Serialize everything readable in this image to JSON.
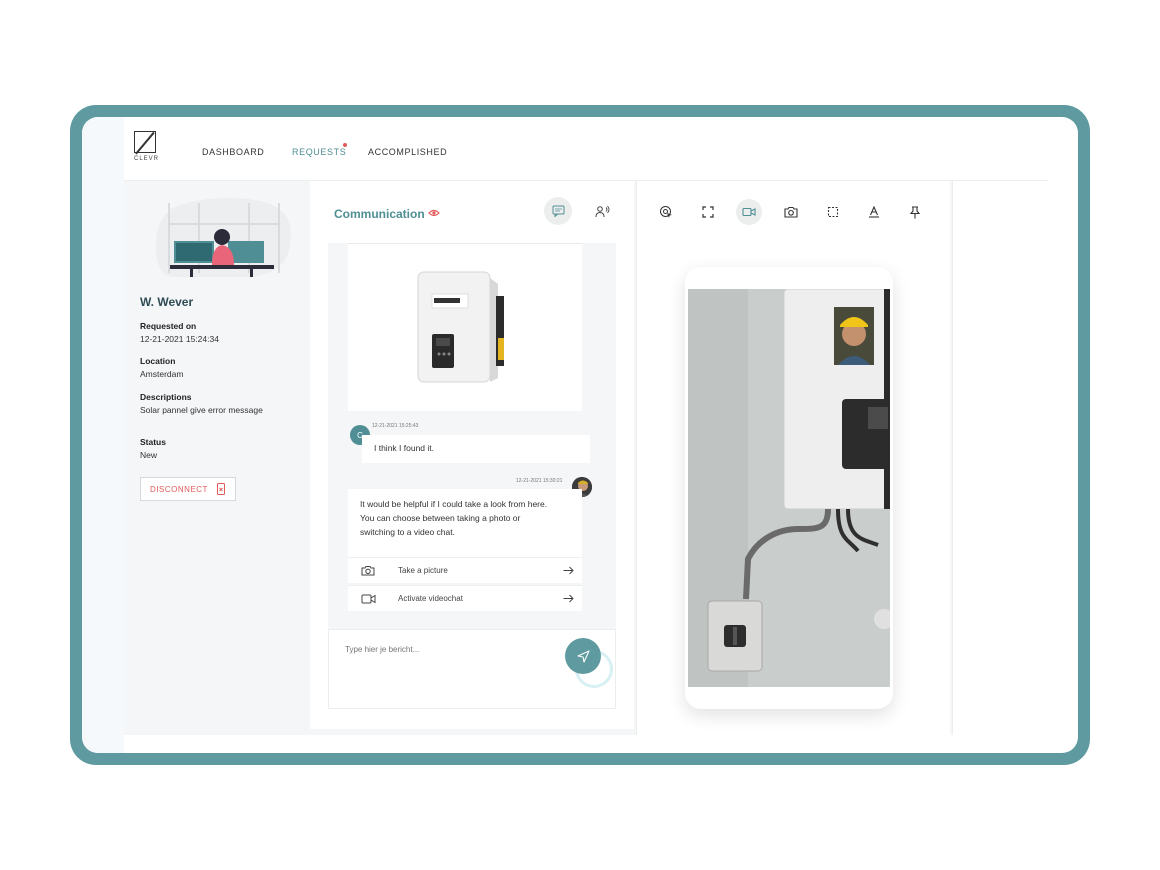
{
  "nav": {
    "logo_text": "CLEVR",
    "items": [
      {
        "label": "DASHBOARD"
      },
      {
        "label": "REQUESTS"
      },
      {
        "label": "ACCOMPLISHED"
      }
    ]
  },
  "request": {
    "user_name": "W. Wever",
    "requested_on_label": "Requested on",
    "requested_on_value": "12-21-2021  15:24:34",
    "location_label": "Location",
    "location_value": "Amsterdam",
    "description_label": "Descriptions",
    "description_value": "Solar pannel give error message",
    "status_label": "Status",
    "status_value": "New",
    "disconnect_label": "DISCONNECT"
  },
  "communication": {
    "title": "Communication",
    "messages": [
      {
        "avatar": "C",
        "time": "12-21-2021 15:25:43",
        "text": "I think I found it."
      },
      {
        "time": "12-21-2021 15:30:21",
        "lines": [
          "It would be helpful if I could take a look from here.",
          "You can choose between taking a photo or",
          "switching to a video chat."
        ]
      }
    ],
    "actions": [
      {
        "label": "Take a picture",
        "icon": "camera-icon"
      },
      {
        "label": "Activate videochat",
        "icon": "video-icon"
      }
    ],
    "input_placeholder": "Type hier je bericht..."
  },
  "colors": {
    "accent": "#5e9a9f",
    "accent_text": "#4f8e94",
    "danger": "#e25a5a"
  }
}
